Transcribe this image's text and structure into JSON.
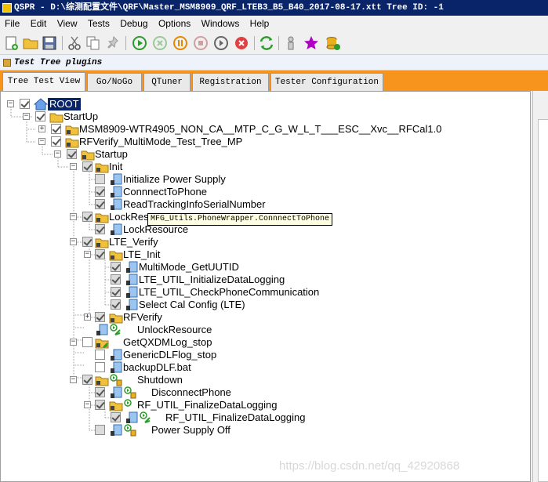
{
  "window": {
    "title": "QSPR - D:\\综测配置文件\\QRF\\Master_MSM8909_QRF_LTEB3_B5_B40_2017-08-17.xtt Tree ID: -1"
  },
  "menu": [
    "File",
    "Edit",
    "View",
    "Tests",
    "Debug",
    "Options",
    "Windows",
    "Help"
  ],
  "toolbar": [
    {
      "name": "new-file-icon"
    },
    {
      "name": "open-folder-icon"
    },
    {
      "name": "save-icon"
    },
    {
      "name": "cut-icon"
    },
    {
      "name": "copy-icon"
    },
    {
      "name": "pin-icon"
    },
    {
      "name": "run-icon"
    },
    {
      "name": "stop-circle-icon"
    },
    {
      "name": "pause-icon"
    },
    {
      "name": "stop-icon"
    },
    {
      "name": "step-icon"
    },
    {
      "name": "cancel-icon"
    },
    {
      "name": "refresh-icon"
    },
    {
      "name": "user-icon"
    },
    {
      "name": "star-icon"
    },
    {
      "name": "database-icon"
    }
  ],
  "plugin_bar": {
    "label": "Test Tree plugins"
  },
  "tabs": [
    "Tree Test View",
    "Go/NoGo",
    "QTuner",
    "Registration",
    "Tester Configuration"
  ],
  "tree": [
    {
      "label": "ROOT"
    },
    {
      "label": "StartUp"
    },
    {
      "label": "MSM8909-WTR4905_NON_CA__MTP_C_G_W_L_T___ESC__Xvc__RFCal1.0"
    },
    {
      "label": "RFVerify_MultiMode_Test_Tree_MP"
    },
    {
      "label": "Startup"
    },
    {
      "label": "Init"
    },
    {
      "label": "Initialize Power Supply"
    },
    {
      "label": "ConnnectToPhone"
    },
    {
      "label": "ReadTrackingInfoSerialNumber"
    },
    {
      "label": "LockRes"
    },
    {
      "label": "LockResource"
    },
    {
      "label": "LTE_Verify"
    },
    {
      "label": "LTE_Init"
    },
    {
      "label": "MultiMode_GetUUTID"
    },
    {
      "label": "LTE_UTIL_InitializeDataLogging"
    },
    {
      "label": "LTE_UTIL_CheckPhoneCommunication"
    },
    {
      "label": "Select Cal Config (LTE)"
    },
    {
      "label": "RFVerify"
    },
    {
      "label": "UnlockResource"
    },
    {
      "label": "GetQXDMLog_stop"
    },
    {
      "label": "GenericDLFlog_stop"
    },
    {
      "label": "backupDLF.bat"
    },
    {
      "label": "Shutdown"
    },
    {
      "label": "DisconnectPhone"
    },
    {
      "label": "RF_UTIL_FinalizeDataLogging"
    },
    {
      "label": "RF_UTIL_FinalizeDataLogging"
    },
    {
      "label": "Power Supply Off"
    }
  ],
  "tooltip": "MFG_Utils.PhoneWrapper.ConnnectToPhone",
  "watermark": "https://blog.csdn.net/qq_42920868"
}
